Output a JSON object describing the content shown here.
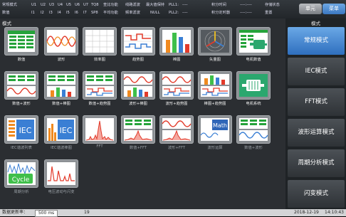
{
  "topbar": {
    "row1": [
      "常规模式",
      "U1",
      "U2",
      "U3",
      "U4",
      "U5",
      "U6",
      "U7",
      "TQ8",
      "查比功能",
      "线路滤波",
      "最大值保持",
      "PLL1:",
      "----",
      "积分时间",
      "----:----",
      "存储状态"
    ],
    "row2": [
      "数值",
      "I1",
      "I2",
      "I3",
      "I4",
      "I5",
      "I6",
      "I7",
      "SP8",
      "平均功能",
      "频率滤波",
      "NULL",
      "PLL2:",
      "----",
      "积分定时器",
      "----:----",
      "重置"
    ],
    "unit_button": "单元",
    "menu_button": "菜单"
  },
  "main": {
    "header": "模式",
    "tiles": [
      {
        "label": "数值",
        "icon": "numeric-table-icon",
        "enabled": true
      },
      {
        "label": "波形",
        "icon": "waveform-icon",
        "enabled": true
      },
      {
        "label": "效率图",
        "icon": "efficiency-chart-icon",
        "enabled": true
      },
      {
        "label": "趋势图",
        "icon": "trend-chart-icon",
        "enabled": true
      },
      {
        "label": "棒图",
        "icon": "bar-chart-icon",
        "enabled": true
      },
      {
        "label": "矢量图",
        "icon": "vector-chart-icon",
        "enabled": true
      },
      {
        "label": "电机数值",
        "icon": "motor-value-icon",
        "enabled": true
      },
      {
        "label": "数值+波形",
        "icon": "numeric-wave-icon",
        "enabled": true
      },
      {
        "label": "数值+棒图",
        "icon": "numeric-bar-icon",
        "enabled": true
      },
      {
        "label": "数值+趋势图",
        "icon": "numeric-trend-icon",
        "enabled": true
      },
      {
        "label": "波形+棒图",
        "icon": "wave-bar-icon",
        "enabled": true
      },
      {
        "label": "波形+趋势图",
        "icon": "wave-trend-icon",
        "enabled": true
      },
      {
        "label": "棒图+趋势图",
        "icon": "bar-trend-icon",
        "enabled": true
      },
      {
        "label": "电机系统",
        "icon": "motor-system-icon",
        "enabled": true
      },
      {
        "label": "IEC谐波列表",
        "icon": "iec-harmonic-list-icon",
        "enabled": false
      },
      {
        "label": "IEC谐波棒图",
        "icon": "iec-harmonic-bar-icon",
        "enabled": false
      },
      {
        "label": "FFT",
        "icon": "fft-icon",
        "enabled": false
      },
      {
        "label": "数值+FFT",
        "icon": "numeric-fft-icon",
        "enabled": false
      },
      {
        "label": "波形+FFT",
        "icon": "wave-fft-icon",
        "enabled": false
      },
      {
        "label": "波形运算",
        "icon": "wave-math-icon",
        "enabled": false
      },
      {
        "label": "数值+波形",
        "icon": "numeric-wave-2-icon",
        "enabled": false
      },
      {
        "label": "周期分析",
        "icon": "cycle-icon",
        "enabled": false
      },
      {
        "label": "电压波动与闪变",
        "icon": "flicker-icon",
        "enabled": false
      }
    ],
    "iec_text": "IEC",
    "math_text": "Math",
    "cycle_text": "Cycle"
  },
  "sidebar": {
    "title": "模式",
    "items": [
      "常规模式",
      "IEC模式",
      "FFT模式",
      "波形运算模式",
      "周期分析模式",
      "闪变模式"
    ]
  },
  "bottombar": {
    "rate_label": "数据更新率：",
    "rate_value": "500 ms",
    "count": "19",
    "date": "2018-12-19",
    "time": "14:10:43"
  },
  "colors": {
    "accent_blue": "#3c7fd0",
    "wave_red": "#e23b2b",
    "wave_blue": "#3a7fd4",
    "bar_green": "#3fbf4a",
    "bar_orange": "#f08a1f",
    "table_green": "#25a33a"
  }
}
